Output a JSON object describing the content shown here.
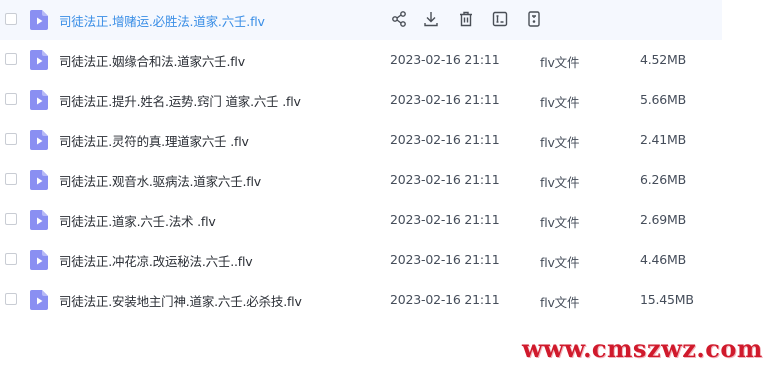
{
  "file_list": {
    "rows": [
      {
        "name": "司徒法正.增赌运.必胜法.道家.六壬.flv",
        "active": true,
        "actions": [
          {
            "icon": "share-icon"
          },
          {
            "icon": "download-icon"
          },
          {
            "icon": "delete-icon"
          },
          {
            "icon": "rename-icon"
          },
          {
            "icon": "more-icon"
          }
        ]
      },
      {
        "name": "司徒法正.姻缘合和法.道家六壬.flv",
        "date": "2023-02-16 21:11",
        "type": "flv文件",
        "size": "4.52MB"
      },
      {
        "name": "司徒法正.提升.姓名.运势.窍门 道家.六壬 .flv",
        "date": "2023-02-16 21:11",
        "type": "flv文件",
        "size": "5.66MB"
      },
      {
        "name": "司徒法正.灵符的真.理道家六壬 .flv",
        "date": "2023-02-16 21:11",
        "type": "flv文件",
        "size": "2.41MB"
      },
      {
        "name": "司徒法正.观音水.驱病法.道家六壬.flv",
        "date": "2023-02-16 21:11",
        "type": "flv文件",
        "size": "6.26MB"
      },
      {
        "name": "司徒法正.道家.六壬.法术 .flv",
        "date": "2023-02-16 21:11",
        "type": "flv文件",
        "size": "2.69MB"
      },
      {
        "name": "司徒法正.冲花凉.改运秘法.六壬..flv",
        "date": "2023-02-16 21:11",
        "type": "flv文件",
        "size": "4.46MB"
      },
      {
        "name": "司徒法正.安装地主门神.道家.六壬.必杀技.flv",
        "date": "2023-02-16 21:11",
        "type": "flv文件",
        "size": "15.45MB"
      }
    ]
  },
  "watermark": {
    "text": "www.cmszwz.com"
  },
  "colors": {
    "accent": "#3a8ee6",
    "file_icon": "#8a8ff2",
    "active_row_bg": "#f5f8fe",
    "watermark": "#d01a2c"
  }
}
